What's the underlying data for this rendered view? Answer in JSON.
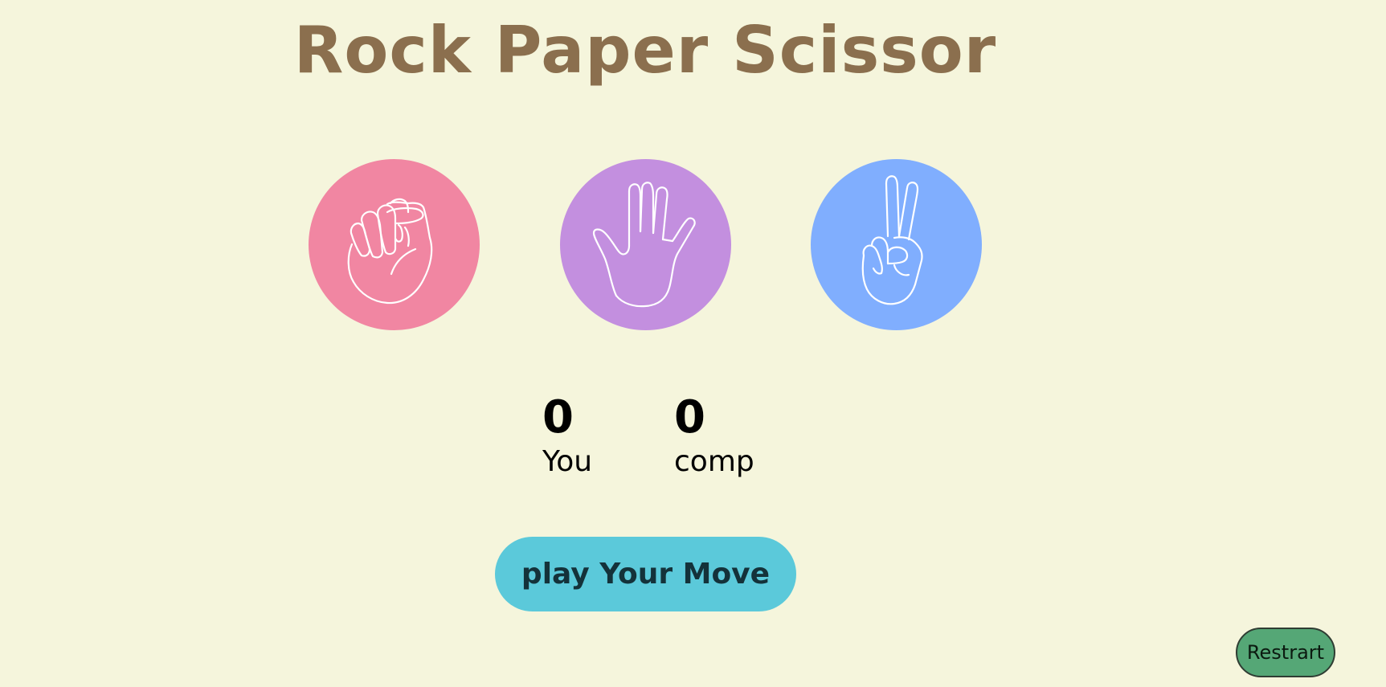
{
  "game": {
    "title": "Rock Paper Scissor",
    "choices": [
      {
        "name": "rock",
        "icon": "rock-fist-icon",
        "color": "#f186a2"
      },
      {
        "name": "paper",
        "icon": "paper-hand-icon",
        "color": "#c38fdf"
      },
      {
        "name": "scissor",
        "icon": "scissor-hand-icon",
        "color": "#80aefe"
      }
    ],
    "score": {
      "you_value": "0",
      "you_label": "You",
      "comp_value": "0",
      "comp_label": "comp"
    },
    "message": "play Your Move",
    "restart_label": "Restrart"
  },
  "colors": {
    "background": "#f5f5dc",
    "title": "#8b6f4e",
    "message_bg": "#5bc9da",
    "restart_bg": "#55a776"
  }
}
